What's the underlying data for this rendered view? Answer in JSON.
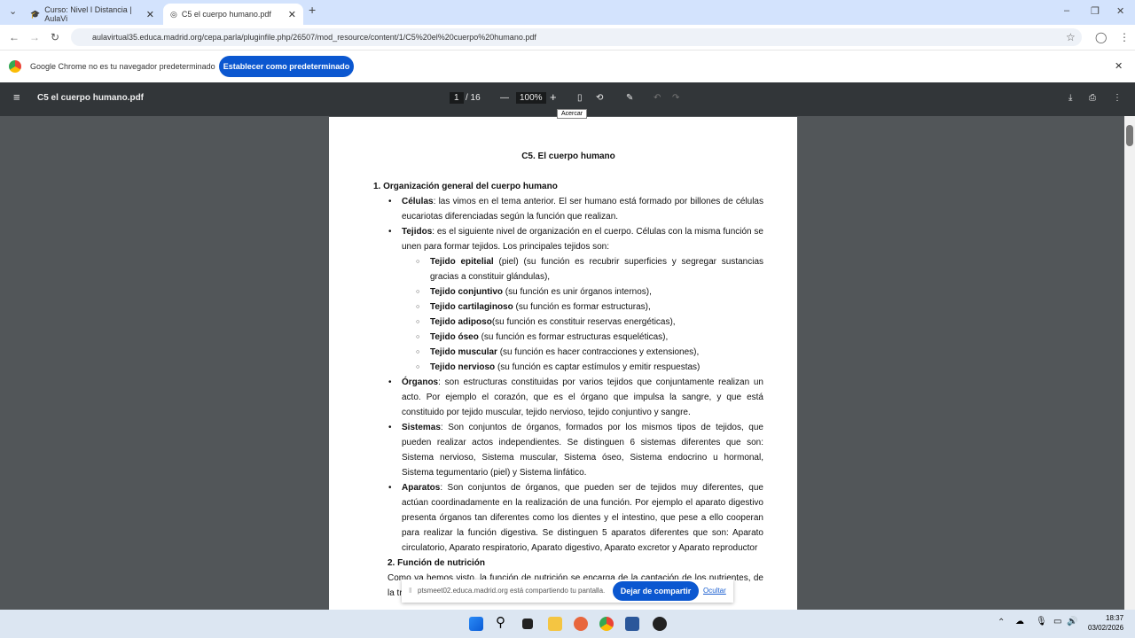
{
  "tabs": [
    {
      "label": "Curso: Nivel I Distancia | AulaVi"
    },
    {
      "label": "C5 el cuerpo humano.pdf"
    }
  ],
  "url": "aulavirtual35.educa.madrid.org/cepa.parla/pluginfile.php/26507/mod_resource/content/1/C5%20el%20cuerpo%20humano.pdf",
  "infobar": {
    "text": "Google Chrome no es tu navegador predeterminado",
    "button": "Establecer como predeterminado"
  },
  "viewer": {
    "filename": "C5 el cuerpo humano.pdf",
    "page": "1",
    "total": "/ 16",
    "zoom": "100%",
    "tooltip": "Acercar"
  },
  "doc": {
    "title": "C5. El cuerpo humano",
    "section1": "1. Organización general del cuerpo humano",
    "bullets": [
      {
        "bold": "Células",
        "text": ": las vimos en el tema anterior. El ser humano está formado por billones de células eucariotas diferenciadas según la función que realizan."
      },
      {
        "bold": "Tejidos",
        "text": ": es el siguiente nivel de organización en el cuerpo. Células con la misma función se unen para formar tejidos. Los principales tejidos son:"
      },
      {
        "bold": "Órganos",
        "text": ": son estructuras constituidas por varios tejidos que conjuntamente realizan un acto. Por ejemplo el corazón, que es el órgano que impulsa la sangre, y que está constituido por tejido muscular, tejido nervioso, tejido conjuntivo y sangre."
      },
      {
        "bold": "Sistemas",
        "text": ": Son conjuntos de órganos, formados por los mismos tipos de tejidos, que pueden realizar actos independientes. Se distinguen 6 sistemas diferentes que son: Sistema nervioso, Sistema muscular, Sistema óseo, Sistema endocrino u hormonal, Sistema tegumentario (piel) y Sistema linfático."
      },
      {
        "bold": "Aparatos",
        "text": ": Son conjuntos de órganos, que pueden ser de tejidos muy diferentes, que actúan coordinadamente en la realización de una función. Por ejemplo el aparato digestivo presenta órganos tan diferentes como los dientes y el intestino, que pese a ello cooperan para realizar la función digestiva. Se distinguen 5 aparatos diferentes que son: Aparato circulatorio, Aparato respiratorio, Aparato digestivo, Aparato excretor y Aparato reproductor"
      }
    ],
    "tejidos": [
      {
        "bold": "Tejido epitelial",
        "text": " (piel) (su función es recubrir superficies y segregar sustancias gracias a constituir glándulas),"
      },
      {
        "bold": "Tejido conjuntivo",
        "text": " (su función es unir órganos internos),"
      },
      {
        "bold": "Tejido cartilaginoso",
        "text": " (su función es formar estructuras),"
      },
      {
        "bold": "Tejido adiposo",
        "text": "(su función es constituir reservas energéticas),"
      },
      {
        "bold": "Tejido óseo",
        "text": " (su función es formar estructuras esqueléticas),"
      },
      {
        "bold": "Tejido muscular",
        "text": " (su función es hacer contracciones y extensiones),"
      },
      {
        "bold": "Tejido nervioso",
        "text": " (su función es captar estímulos y emitir respuestas)"
      }
    ],
    "section2": "2. Función de nutrición",
    "para2": "Como ya hemos visto, la función de nutrición se encarga de la captación de los nutrientes, de la transformación de los mismos y de la eliminación de los productos de desecho."
  },
  "share": {
    "text": "ptsmeet02.educa.madrid.org está compartiendo tu pantalla.",
    "stop": "Dejar de compartir",
    "hide": "Ocultar"
  },
  "clock": {
    "time": "18:37",
    "date": "03/02/2026"
  }
}
